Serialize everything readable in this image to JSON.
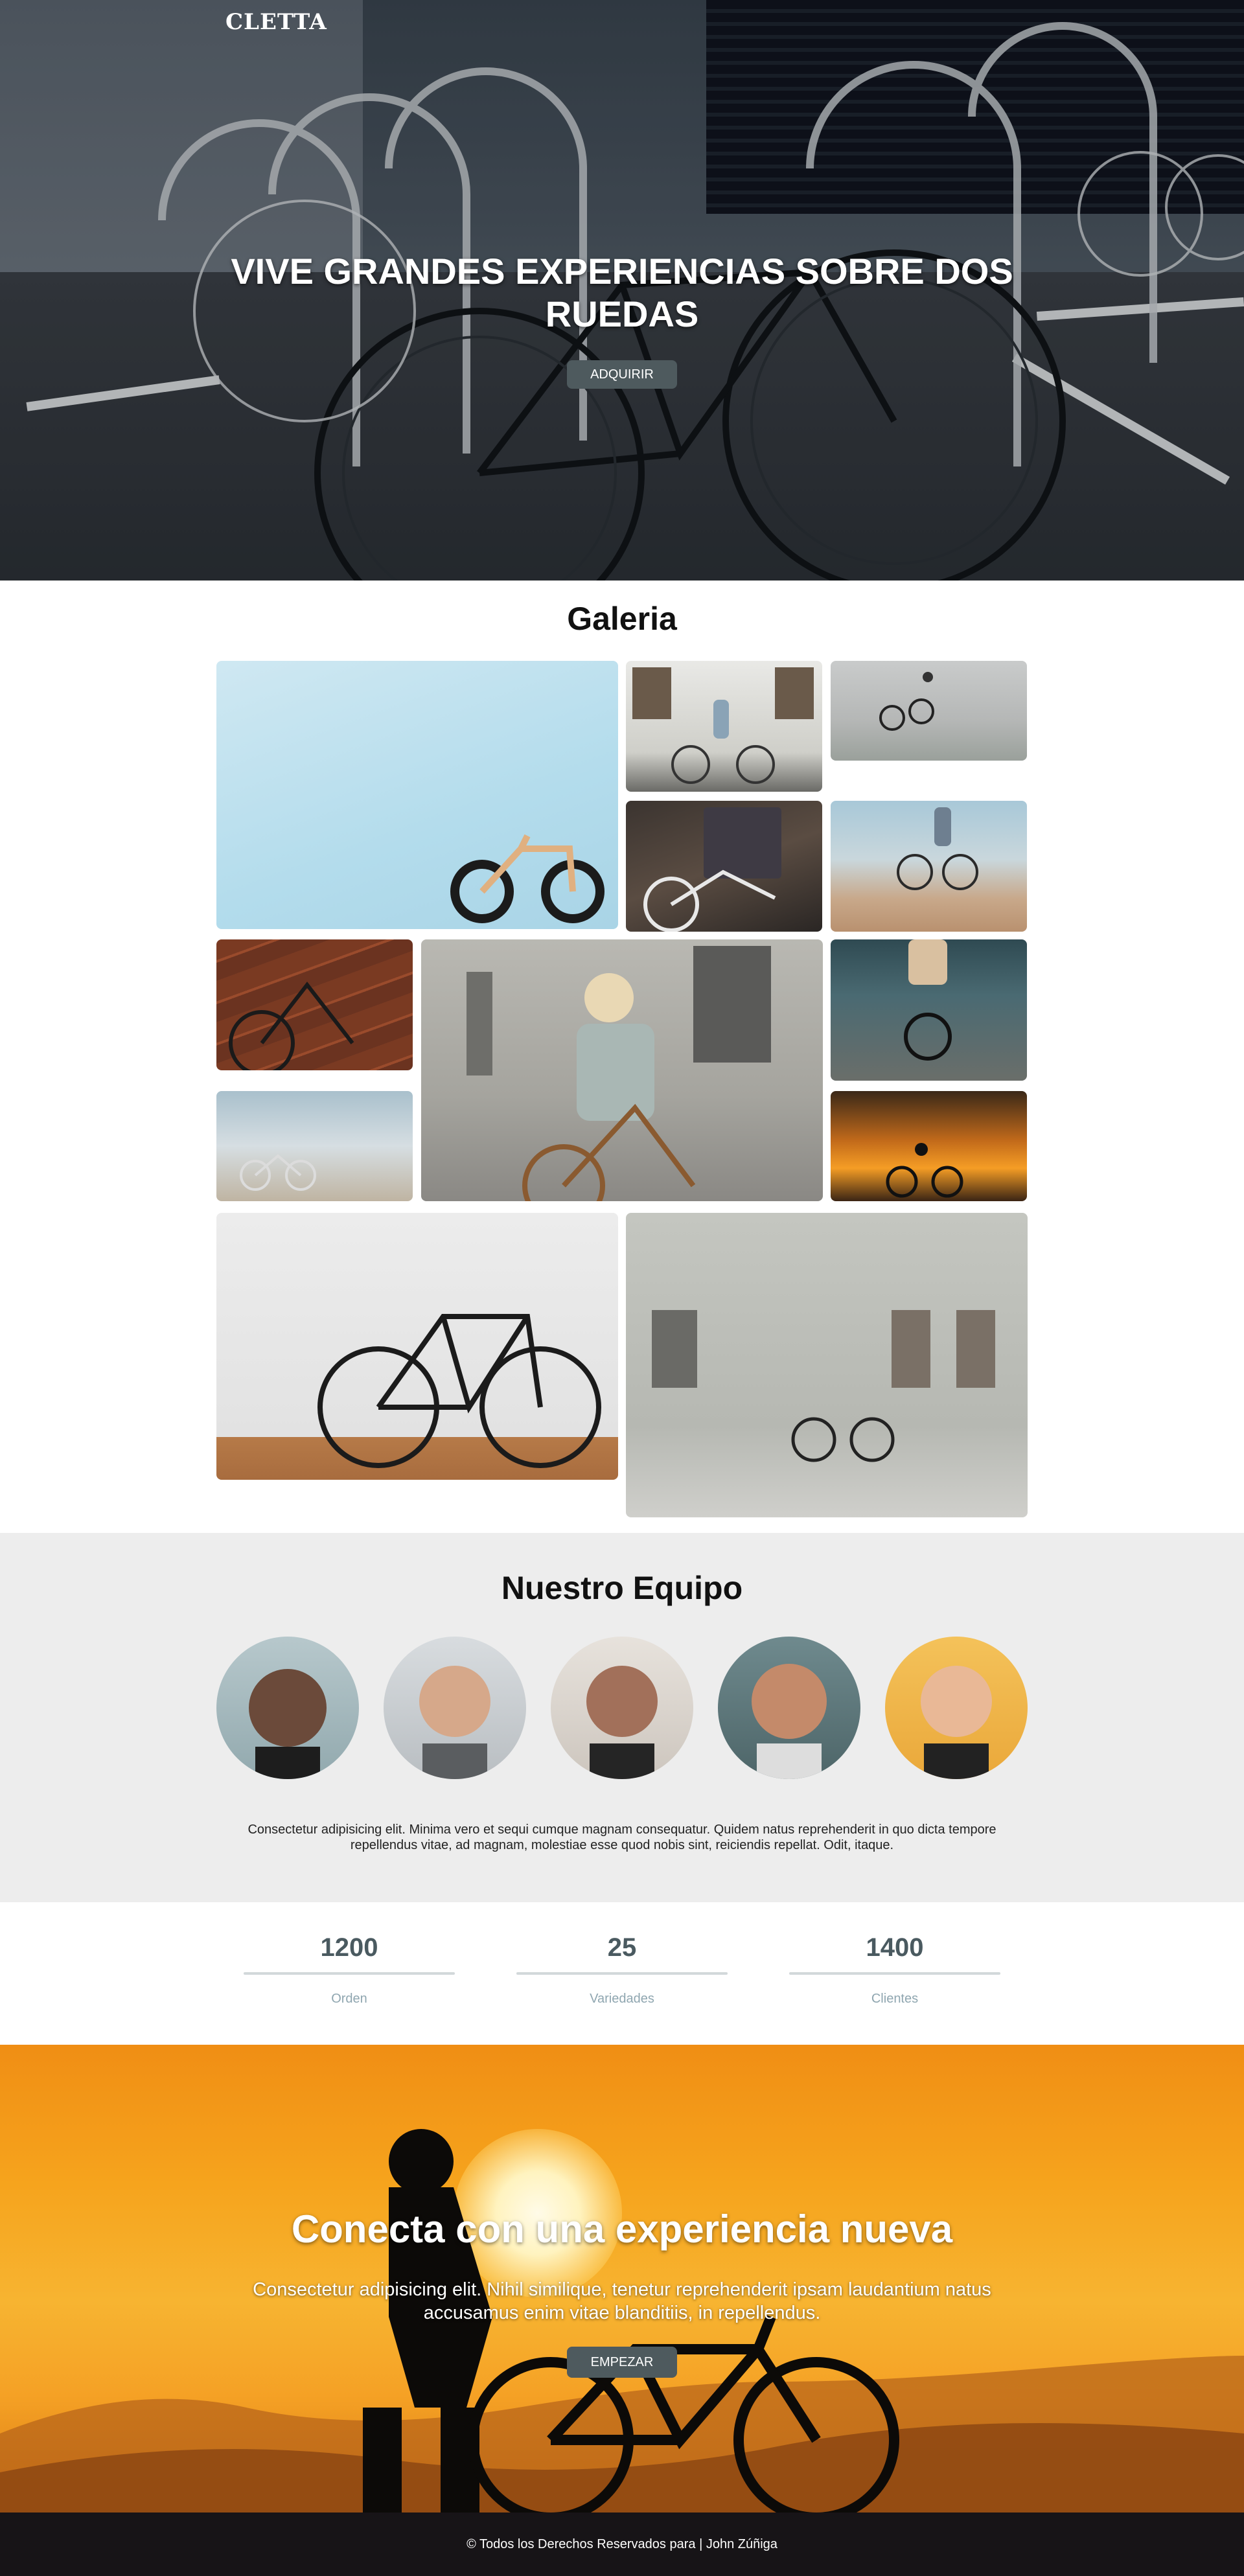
{
  "brand": {
    "logo_text": "CLETTA"
  },
  "hero": {
    "title": "VIVE GRANDES EXPERIENCIAS SOBRE DOS RUEDAS",
    "button_label": "ADQUIRIR"
  },
  "gallery": {
    "title": "Galeria",
    "photos": [
      "bmx-blue-wall",
      "woman-riding-street",
      "bmx-jump-park",
      "bike-tool-shop",
      "cyclist-pier",
      "bike-brick-wall",
      "woman-smiling-bike",
      "mountain-biker-road",
      "bike-beach",
      "sunset-cyclist",
      "bike-white-wall",
      "bike-grey-building"
    ]
  },
  "team": {
    "title": "Nuestro Equipo",
    "members": [
      "member-1",
      "member-2",
      "member-3",
      "member-4",
      "member-5"
    ],
    "description": "Consectetur adipisicing elit. Minima vero et sequi cumque magnam consequatur. Quidem natus reprehenderit in quo dicta tempore repellendus vitae, ad magnam, molestiae esse quod nobis sint, reiciendis repellat. Odit, itaque."
  },
  "stats": [
    {
      "value": "1200",
      "label": "Orden"
    },
    {
      "value": "25",
      "label": "Variedades"
    },
    {
      "value": "1400",
      "label": "Clientes"
    }
  ],
  "cta": {
    "title": "Conecta con una experiencia nueva",
    "text": "Consectetur adipisicing elit. Nihil similique, tenetur reprehenderit ipsam laudantium natus accusamus enim vitae blanditiis, in repellendus.",
    "button_label": "EMPEZAR"
  },
  "footer": {
    "text": "© Todos los Derechos Reservados para | John Zúñiga"
  },
  "colors": {
    "button": "#4e5a5e",
    "stat_number": "#4a5a60",
    "stat_label": "#8fa6b0",
    "footer_bg": "#171417",
    "team_bg": "#ededed"
  }
}
